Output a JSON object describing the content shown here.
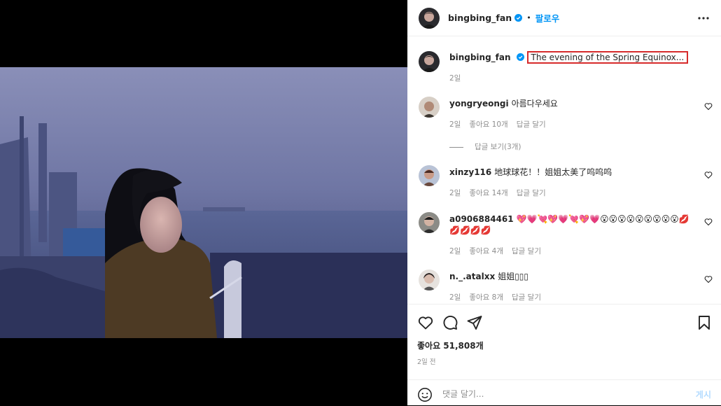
{
  "header": {
    "username": "bingbing_fan",
    "dot": "•",
    "follow_label": "팔로우"
  },
  "caption": {
    "username": "bingbing_fan",
    "text": "The evening of the Spring Equinox...",
    "time": "2일"
  },
  "comments": [
    {
      "username": "yongryeongi",
      "text": "아름다우세요",
      "time": "2일",
      "likes": "좋아요 10개",
      "reply": "답글 달기",
      "view_replies": "답글 보기(3개)"
    },
    {
      "username": "xinzy116",
      "text": "地球球花！！姐姐太美了呜呜呜",
      "time": "2일",
      "likes": "좋아요 14개",
      "reply": "답글 달기"
    },
    {
      "username": "a0906884461",
      "text": "💖💗💘💖💗💘💖💗😮😮😮😮😮😮😮😮😮💋💋💋💋💋",
      "time": "2일",
      "likes": "좋아요 4개",
      "reply": "답글 달기"
    },
    {
      "username": "n._.atalxx",
      "text": "姐姐▯▯▯",
      "time": "2일",
      "likes": "좋아요 8개",
      "reply": "답글 달기"
    }
  ],
  "likes_text": "좋아요 51,808개",
  "date_text": "2일 전",
  "comment_input": {
    "placeholder": "댓글 달기...",
    "post_label": "게시"
  },
  "icons": {
    "verified": "verified-badge-icon",
    "more": "more-options-icon",
    "like": "heart-icon",
    "comment": "comment-icon",
    "share": "paper-plane-icon",
    "save": "bookmark-icon",
    "emoji": "emoji-icon"
  },
  "colors": {
    "accent": "#0095f6",
    "highlight": "#d62b2b",
    "muted": "#8e8e8e"
  }
}
